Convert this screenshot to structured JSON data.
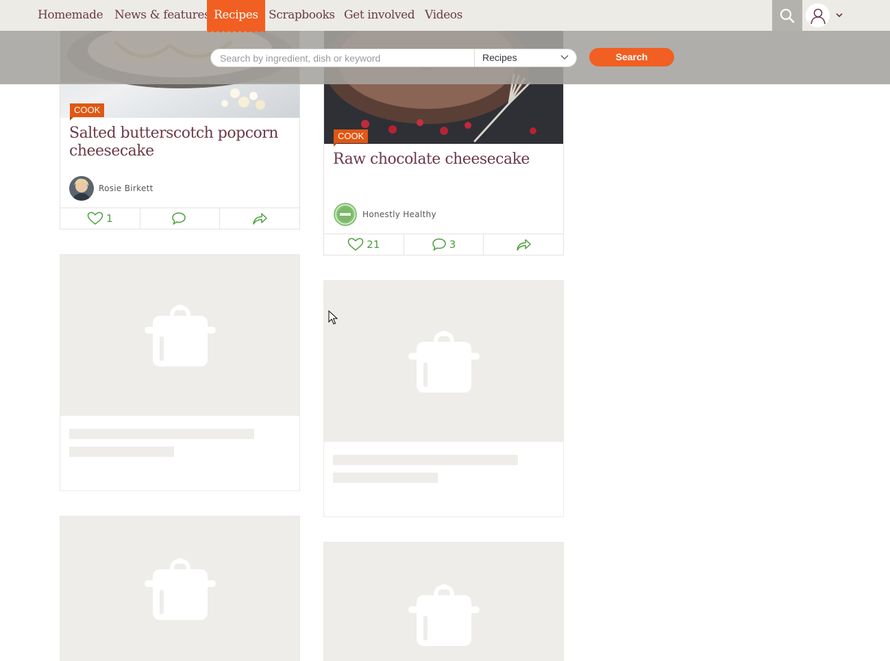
{
  "nav": {
    "items": [
      {
        "label": "Homemade"
      },
      {
        "label": "News & features"
      },
      {
        "label": "Recipes",
        "active": true
      },
      {
        "label": "Scrapbooks"
      },
      {
        "label": "Get involved"
      },
      {
        "label": "Videos"
      }
    ],
    "search_icon": "search-icon",
    "user_icon": "user-icon"
  },
  "search": {
    "placeholder": "Search by ingredient, dish or keyword",
    "value": "",
    "category": "Recipes",
    "button_label": "Search"
  },
  "cards": [
    {
      "tag": "COOK",
      "title": "Salted butterscotch popcorn cheesecake",
      "author": "Rosie Birkett",
      "likes": "1",
      "comments": "",
      "image": "cheesecake-with-popcorn-photo"
    },
    {
      "tag": "COOK",
      "title": "Raw chocolate cheesecake",
      "author": "Honestly Healthy",
      "likes": "21",
      "comments": "3",
      "image": "chocolate-cheesecake-photo"
    }
  ],
  "placeholder_icon": "cooking-pot-icon",
  "colors": {
    "accent": "#f15f22",
    "title": "#6b3a46",
    "action_green": "#4a9d3b",
    "nav_bg": "#ecebe6"
  }
}
